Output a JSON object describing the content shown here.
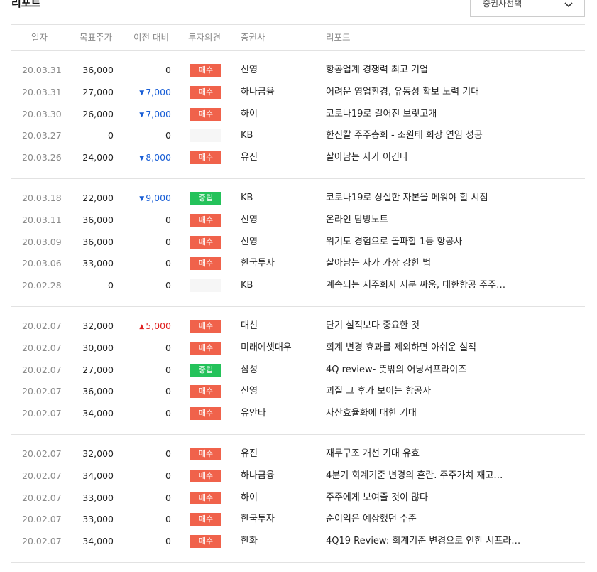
{
  "header": {
    "title": "리포트",
    "broker_select": "증권사선택"
  },
  "columns": [
    "일자",
    "목표주가",
    "이전 대비",
    "투자의견",
    "증권사",
    "리포트"
  ],
  "colors": {
    "buy": "#f0624b",
    "hold": "#24c25a",
    "down": "#1a5fd6",
    "up": "#e02020"
  },
  "groups": [
    {
      "rows": [
        {
          "date": "20.03.31",
          "target": "36,000",
          "change": "0",
          "dir": "none",
          "opinion": "매수",
          "type": "buy",
          "broker": "신영",
          "report": "항공업계 경쟁력 최고 기업"
        },
        {
          "date": "20.03.31",
          "target": "27,000",
          "change": "7,000",
          "dir": "down",
          "opinion": "매수",
          "type": "buy",
          "broker": "하나금융",
          "report": "어려운 영업환경, 유동성 확보 노력 기대"
        },
        {
          "date": "20.03.30",
          "target": "26,000",
          "change": "7,000",
          "dir": "down",
          "opinion": "매수",
          "type": "buy",
          "broker": "하이",
          "report": "코로나19로 길어진 보릿고개"
        },
        {
          "date": "20.03.27",
          "target": "0",
          "change": "0",
          "dir": "none",
          "opinion": "",
          "type": "none",
          "broker": "KB",
          "report": "한진칼 주주총회 - 조원태 회장 연임 성공"
        },
        {
          "date": "20.03.26",
          "target": "24,000",
          "change": "8,000",
          "dir": "down",
          "opinion": "매수",
          "type": "buy",
          "broker": "유진",
          "report": "살아남는 자가 이긴다"
        }
      ]
    },
    {
      "rows": [
        {
          "date": "20.03.18",
          "target": "22,000",
          "change": "9,000",
          "dir": "down",
          "opinion": "중립",
          "type": "hold",
          "broker": "KB",
          "report": "코로나19로 상실한 자본을 메워야 할 시점"
        },
        {
          "date": "20.03.11",
          "target": "36,000",
          "change": "0",
          "dir": "none",
          "opinion": "매수",
          "type": "buy",
          "broker": "신영",
          "report": "온라인 탐방노트"
        },
        {
          "date": "20.03.09",
          "target": "36,000",
          "change": "0",
          "dir": "none",
          "opinion": "매수",
          "type": "buy",
          "broker": "신영",
          "report": "위기도 경험으로 돌파할 1등 항공사"
        },
        {
          "date": "20.03.06",
          "target": "33,000",
          "change": "0",
          "dir": "none",
          "opinion": "매수",
          "type": "buy",
          "broker": "한국투자",
          "report": "살아남는 자가 가장 강한 법"
        },
        {
          "date": "20.02.28",
          "target": "0",
          "change": "0",
          "dir": "none",
          "opinion": "",
          "type": "none",
          "broker": "KB",
          "report": "계속되는 지주회사 지분 싸움, 대한항공 주주…"
        }
      ]
    },
    {
      "rows": [
        {
          "date": "20.02.07",
          "target": "32,000",
          "change": "5,000",
          "dir": "up",
          "opinion": "매수",
          "type": "buy",
          "broker": "대신",
          "report": "단기 실적보다 중요한 것"
        },
        {
          "date": "20.02.07",
          "target": "30,000",
          "change": "0",
          "dir": "none",
          "opinion": "매수",
          "type": "buy",
          "broker": "미래에셋대우",
          "report": "회계 변경 효과를 제외하면 아쉬운 실적"
        },
        {
          "date": "20.02.07",
          "target": "27,000",
          "change": "0",
          "dir": "none",
          "opinion": "중립",
          "type": "hold",
          "broker": "삼성",
          "report": "4Q review- 뜻밖의 어닝서프라이즈"
        },
        {
          "date": "20.02.07",
          "target": "36,000",
          "change": "0",
          "dir": "none",
          "opinion": "매수",
          "type": "buy",
          "broker": "신영",
          "report": "괴질 그 후가 보이는 항공사"
        },
        {
          "date": "20.02.07",
          "target": "34,000",
          "change": "0",
          "dir": "none",
          "opinion": "매수",
          "type": "buy",
          "broker": "유안타",
          "report": "자산효율화에 대한 기대"
        }
      ]
    },
    {
      "rows": [
        {
          "date": "20.02.07",
          "target": "32,000",
          "change": "0",
          "dir": "none",
          "opinion": "매수",
          "type": "buy",
          "broker": "유진",
          "report": "재무구조 개선 기대 유효"
        },
        {
          "date": "20.02.07",
          "target": "34,000",
          "change": "0",
          "dir": "none",
          "opinion": "매수",
          "type": "buy",
          "broker": "하나금융",
          "report": "4분기 회계기준 변경의 혼란. 주주가치 재고…"
        },
        {
          "date": "20.02.07",
          "target": "33,000",
          "change": "0",
          "dir": "none",
          "opinion": "매수",
          "type": "buy",
          "broker": "하이",
          "report": "주주에게 보여줄 것이 많다"
        },
        {
          "date": "20.02.07",
          "target": "33,000",
          "change": "0",
          "dir": "none",
          "opinion": "매수",
          "type": "buy",
          "broker": "한국투자",
          "report": "순이익은 예상했던 수준"
        },
        {
          "date": "20.02.07",
          "target": "34,000",
          "change": "0",
          "dir": "none",
          "opinion": "매수",
          "type": "buy",
          "broker": "한화",
          "report": "4Q19 Review: 회계기준 변경으로 인한 서프라…"
        }
      ]
    }
  ]
}
